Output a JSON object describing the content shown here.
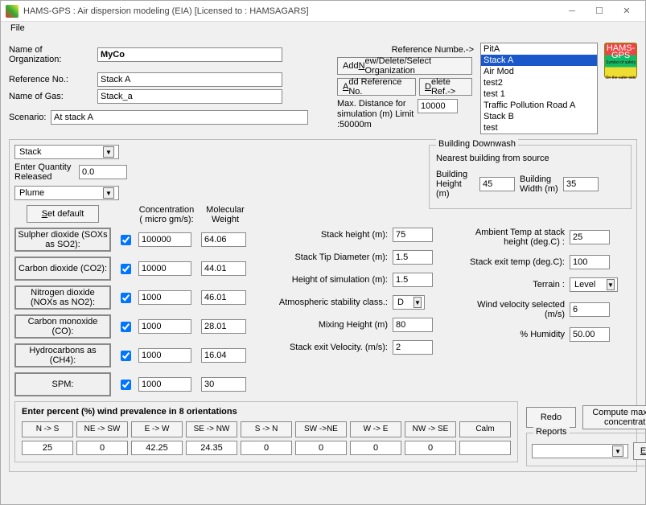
{
  "window": {
    "title": "HAMS-GPS : Air dispersion modeling (EIA) [Licensed to : HAMSAGARS]",
    "menu_file": "File"
  },
  "top": {
    "org_label": "Name of Organization:",
    "org_value": "MyCo",
    "refno_label": "Reference No.:",
    "refno_value": "Stack A",
    "gas_label": "Name of Gas:",
    "gas_value": "Stack_a",
    "scenario_label": "Scenario:",
    "scenario_value": "At stack A",
    "refnum_label": "Reference Numbe.->",
    "btn_add_new": "Add New/Delete/Select Organization",
    "btn_add_ref": "Add Reference No.",
    "btn_del_ref": "Delete Ref.->",
    "maxdist_label": "Max. Distance for simulation (m) Limit :50000m",
    "maxdist_value": "10000",
    "listbox": [
      "PitA",
      "Stack A",
      "Air Mod",
      "test2",
      "test 1",
      "Traffic Pollution Road A",
      "Stack B",
      "test"
    ],
    "listbox_selected": 1,
    "logo_top": "HAMS-GPS",
    "logo_bot": "On the safer side"
  },
  "left": {
    "source_type": "Stack",
    "qty_label": "Enter Quantity Released",
    "qty_value": "0.0",
    "model_type": "Plume",
    "set_default": "Set default",
    "col_conc": "Concentration ( micro gm/s):",
    "col_mw": "Molecular Weight",
    "species": [
      {
        "name": "Sulpher dioxide (SOXs as SO2):",
        "chk": true,
        "conc": "100000",
        "mw": "64.06"
      },
      {
        "name": "Carbon dioxide (CO2):",
        "chk": true,
        "conc": "10000",
        "mw": "44.01"
      },
      {
        "name": "Nitrogen dioxide (NOXs as NO2):",
        "chk": true,
        "conc": "1000",
        "mw": "46.01"
      },
      {
        "name": "Carbon monoxide (CO):",
        "chk": true,
        "conc": "1000",
        "mw": "28.01"
      },
      {
        "name": "Hydrocarbons as (CH4):",
        "chk": true,
        "conc": "1000",
        "mw": "16.04"
      },
      {
        "name": "SPM:",
        "chk": true,
        "conc": "1000",
        "mw": "30"
      }
    ]
  },
  "downwash": {
    "title": "Building Downwash",
    "sub": "Nearest building from source",
    "bh_label": "Building Height (m)",
    "bh_value": "45",
    "bw_label": "Building Width (m)",
    "bw_value": "35"
  },
  "mid": {
    "stack_h_label": "Stack height (m):",
    "stack_h": "75",
    "tip_d_label": "Stack Tip Diameter (m):",
    "tip_d": "1.5",
    "sim_h_label": "Height of simulation (m):",
    "sim_h": "1.5",
    "stab_label": "Atmospheric stability class.:",
    "stab": "D",
    "mix_h_label": "Mixing Height (m)",
    "mix_h": "80",
    "exit_v_label": "Stack exit Velocity.  (m/s):",
    "exit_v": "2",
    "amb_t_label": "Ambient Temp at stack height (deg.C) :",
    "amb_t": "25",
    "exit_t_label": "Stack exit temp  (deg.C):",
    "exit_t": "100",
    "terrain_label": "Terrain :",
    "terrain": "Level",
    "wind_v_label": "Wind velocity selected (m/s)",
    "wind_v": "6",
    "hum_label": "% Humidity",
    "hum": "50.00"
  },
  "wind": {
    "title": "Enter percent (%) wind prevalence in 8 orientations",
    "dirs": [
      "N -> S",
      "NE -> SW",
      "E -> W",
      "SE -> NW",
      "S -> N",
      "SW ->NE",
      "W -> E",
      "NW -> SE",
      "Calm"
    ],
    "vals": [
      "25",
      "0",
      "42.25",
      "24.35",
      "0",
      "0",
      "0",
      "0",
      ""
    ]
  },
  "bottom": {
    "redo": "Redo",
    "compute": "Compute maximum concentration",
    "reports_label": "Reports",
    "reports_value": "",
    "exit": "Exit"
  }
}
